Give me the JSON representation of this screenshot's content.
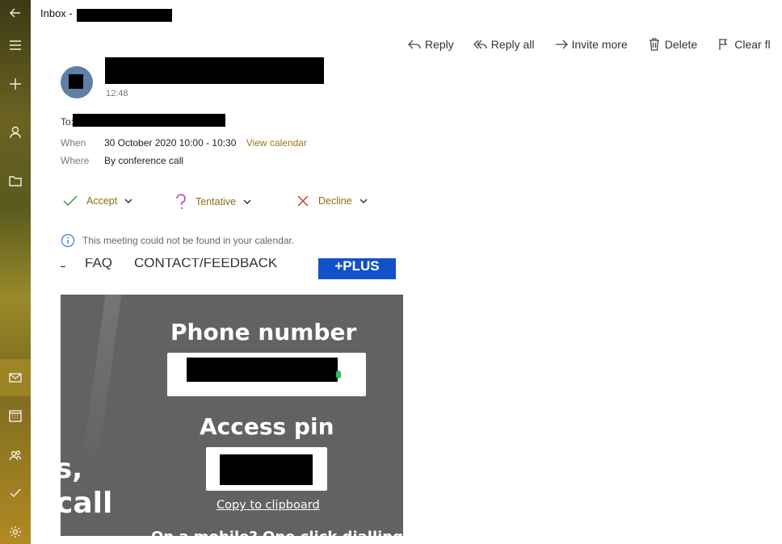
{
  "header": {
    "inbox_prefix": "Inbox -"
  },
  "toolbar": {
    "reply": "Reply",
    "reply_all": "Reply all",
    "invite_more": "Invite more",
    "delete": "Delete",
    "clear_flag": "Clear fl"
  },
  "message": {
    "time": "12:48",
    "to_label": "To:",
    "when_label": "When",
    "when_value": "30 October 2020 10:00 - 10:30",
    "view_calendar": "View calendar",
    "where_label": "Where",
    "where_value": "By conference call"
  },
  "responses": {
    "accept": "Accept",
    "tentative": "Tentative",
    "decline": "Decline"
  },
  "info_text": "This meeting could not be found in your calendar.",
  "embed": {
    "nav_left": "L",
    "nav_faq": "FAQ",
    "nav_contact": "CONTACT/FEEDBACK",
    "nav_plus": "+PLUS",
    "phone_heading": "Phone number",
    "pin_heading": "Access pin",
    "copy_link": "Copy to clipboard",
    "left_text_1": "s,",
    "left_text_2": "call",
    "bottom_text": "On a mobile? One click dialling"
  },
  "colors": {
    "accent": "#9a7b10",
    "plus_button": "#1252c9",
    "avatar": "#5f7fa5"
  }
}
